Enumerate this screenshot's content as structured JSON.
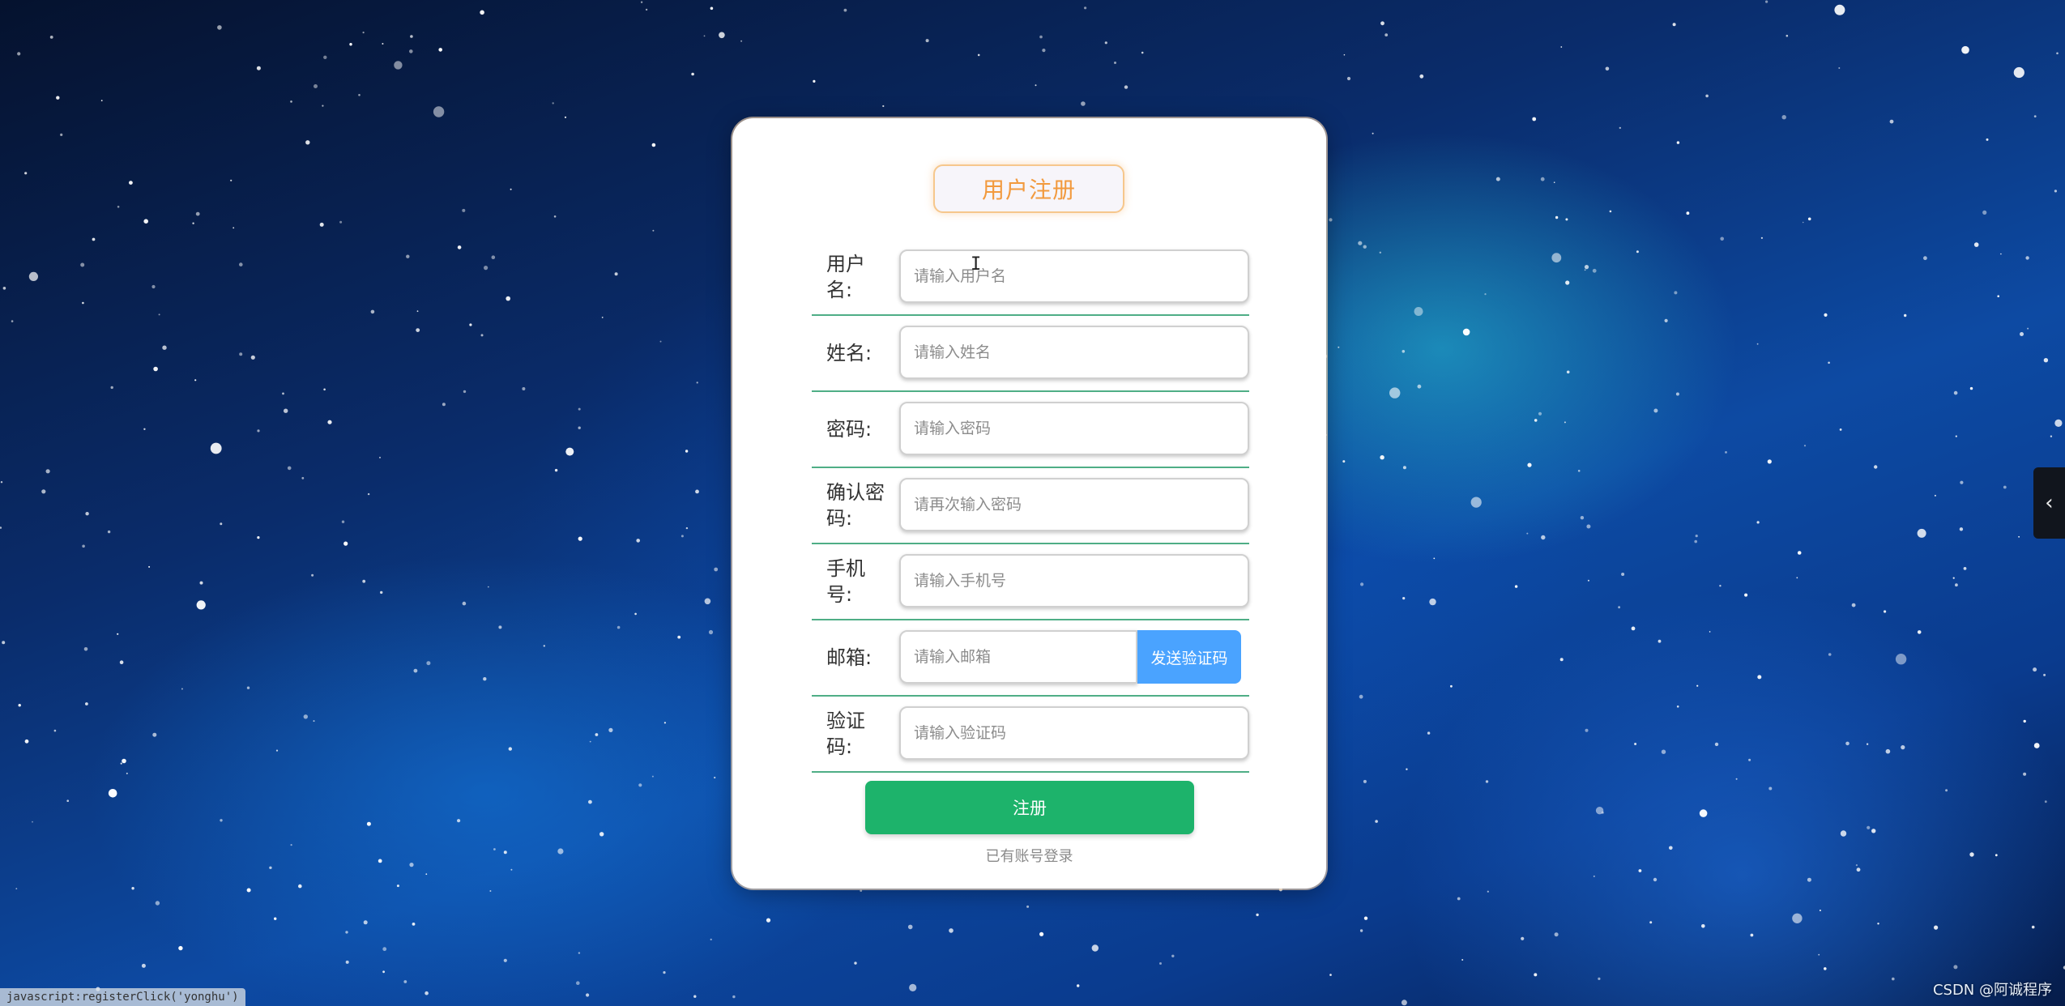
{
  "form": {
    "title": "用户注册",
    "fields": [
      {
        "label": "用户\n名:",
        "placeholder": "请输入用户名"
      },
      {
        "label": "姓名:",
        "placeholder": "请输入姓名"
      },
      {
        "label": "密码:",
        "placeholder": "请输入密码"
      },
      {
        "label": "确认密\n码:",
        "placeholder": "请再次输入密码"
      },
      {
        "label": "手机\n号:",
        "placeholder": "请输入手机号"
      },
      {
        "label": "邮箱:",
        "placeholder": "请输入邮箱"
      },
      {
        "label": "验证\n码:",
        "placeholder": "请输入验证码"
      }
    ],
    "send_code_label": "发送验证码",
    "submit_label": "注册",
    "login_link": "已有账号登录"
  },
  "side_toggle_icon": "chevron-left-icon",
  "status_url": "javascript:registerClick('yonghu')",
  "watermark": "CSDN @阿诚程序",
  "colors": {
    "title": "#f29a3e",
    "submit": "#1db36b",
    "send_code": "#4aa3ff",
    "row_border": "#4fae86"
  }
}
